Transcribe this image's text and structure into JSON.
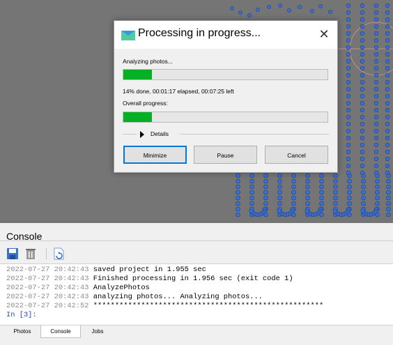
{
  "dialog": {
    "title": "Processing in progress...",
    "close_symbol": "✕",
    "task_label": "Analyzing photos...",
    "task_progress": 0.14,
    "status_text": "14% done, 00:01:17 elapsed, 00:07:25 left",
    "overall_label": "Overall progress:",
    "overall_progress": 0.14,
    "details_label": "Details",
    "buttons": {
      "minimize": "Minimize",
      "pause": "Pause",
      "cancel": "Cancel"
    },
    "accent_color": "#0078d7",
    "progress_color": "#06b025"
  },
  "console": {
    "title": "Console",
    "toolbar_icons": [
      "save-icon",
      "clear-icon",
      "execute-icon"
    ],
    "lines": [
      {
        "timestamp": "2022-07-27 20:42:43",
        "text": "saved project in 1.955 sec"
      },
      {
        "timestamp": "2022-07-27 20:42:43",
        "text": "Finished processing in 1.956 sec (exit code 1)"
      },
      {
        "timestamp": "2022-07-27 20:42:43",
        "text": "AnalyzePhotos"
      },
      {
        "timestamp": "2022-07-27 20:42:43",
        "text": "analyzing photos... Analyzing photos..."
      },
      {
        "timestamp": "2022-07-27 20:42:52",
        "text": "*****************************************************"
      }
    ],
    "prompt": "In [3]:"
  },
  "tabs": [
    {
      "label": "Photos",
      "active": false
    },
    {
      "label": "Console",
      "active": true
    },
    {
      "label": "Jobs",
      "active": false
    }
  ]
}
